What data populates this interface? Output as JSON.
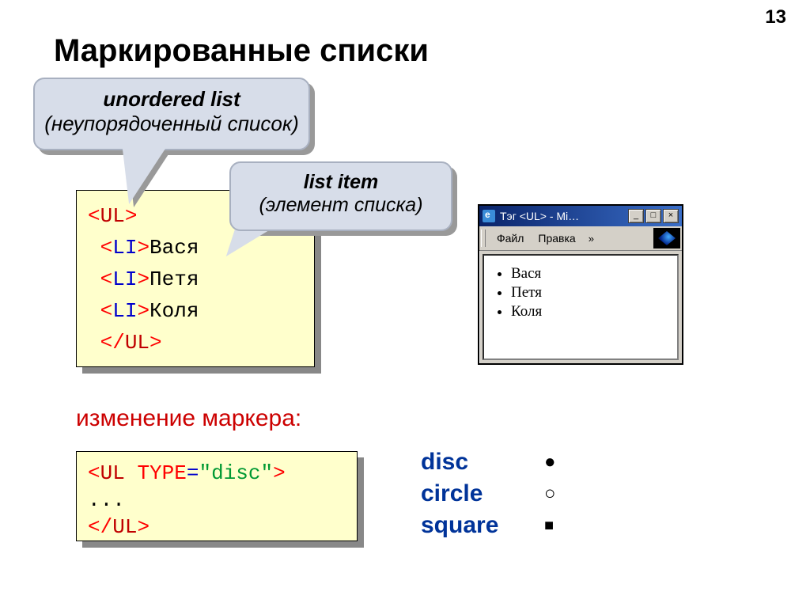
{
  "page_number": "13",
  "title": "Маркированные списки",
  "callout1": {
    "line1": "unordered list",
    "line2": "(неупорядоченный список)"
  },
  "callout2": {
    "line1": "list item",
    "line2": "(элемент списка)"
  },
  "code1": {
    "open_ang": "<",
    "close_ang": ">",
    "open_ang_c": "</",
    "ul": "UL",
    "li": "LI",
    "name1": "Вася",
    "name2": "Петя",
    "name3": "Коля"
  },
  "browser": {
    "title": "Тэг <UL> - Mi…",
    "menu_file": "Файл",
    "menu_edit": "Правка",
    "chevron": "»",
    "items": [
      "Вася",
      "Петя",
      "Коля"
    ]
  },
  "subheading": "изменение маркера:",
  "code2": {
    "ul": "UL",
    "attr": "TYPE",
    "eq": "=",
    "val": "\"disc\"",
    "dots": "...",
    "close": "UL"
  },
  "legend": {
    "disc": "disc",
    "circle": "circle",
    "square": "square",
    "disc_sym": "●",
    "circle_sym": "○",
    "square_sym": "■"
  }
}
